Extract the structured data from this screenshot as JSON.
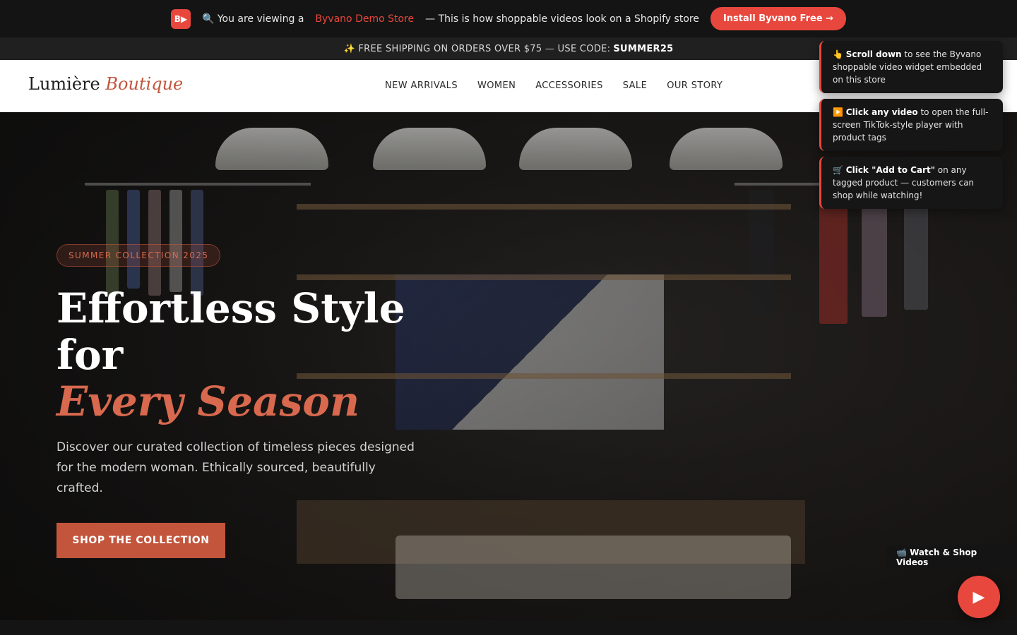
{
  "demo_bar": {
    "logo_text": "B▶",
    "prefix": "🔍 You are viewing a",
    "store_link": "Byvano Demo Store",
    "suffix": "— This is how shoppable videos look on a Shopify store",
    "install_button": "Install Byvano Free →"
  },
  "shipping": {
    "text": "✨ FREE SHIPPING ON ORDERS OVER $75 — USE CODE:",
    "code": "SUMMER25"
  },
  "nav": {
    "brand_main": "Lumière",
    "brand_accent": "Boutique",
    "links": [
      "NEW ARRIVALS",
      "WOMEN",
      "ACCESSORIES",
      "SALE",
      "OUR STORY"
    ]
  },
  "hero": {
    "badge": "SUMMER COLLECTION 2025",
    "title_line1": "Effortless Style for",
    "title_line2": "Every Season",
    "subtitle": "Discover our curated collection of timeless pieces designed for the modern woman. Ethically sourced, beautifully crafted.",
    "cta": "SHOP THE COLLECTION"
  },
  "tips": [
    {
      "emoji": "👆",
      "bold": "Scroll down",
      "rest": " to see the Byvano shoppable video widget embedded on this store"
    },
    {
      "emoji": "▶️",
      "bold": "Click any video",
      "rest": " to open the full-screen TikTok-style player with product tags"
    },
    {
      "emoji": "🛒",
      "bold": "Click \"Add to Cart\"",
      "rest": " on any tagged product — customers can shop while watching!"
    }
  ],
  "widget": {
    "label": "📹 Watch & Shop Videos",
    "play_icon": "▶"
  },
  "colors": {
    "accent": "#e8473d",
    "brand_accent": "#c2553c"
  }
}
